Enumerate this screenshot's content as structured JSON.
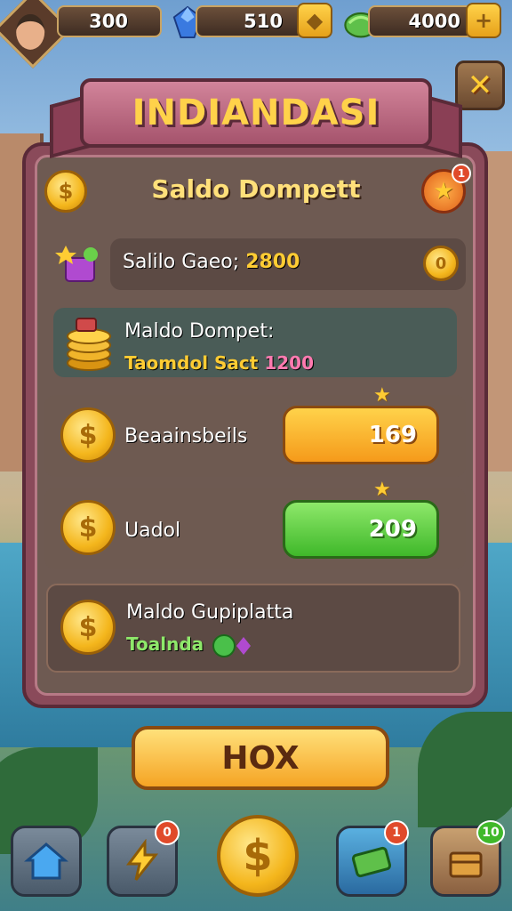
{
  "topbar": {
    "coins_value": "300",
    "gems_value": "510",
    "cash_value": "4000",
    "plus_label": "+"
  },
  "header": {
    "title": "INDIANDASI",
    "close_label": "✕"
  },
  "panel": {
    "title": "Saldo Dompett",
    "star_badge": "1",
    "rows": [
      {
        "label": "Salilo Gaeo;",
        "value": "2800"
      },
      {
        "label": "Maldo Dompet:",
        "sublabel": "Taomdol",
        "subvalue_label": "Sact",
        "subvalue": "1200"
      },
      {
        "label": "Beaainsbeils",
        "button_value": "169"
      },
      {
        "label": "Uadol",
        "button_value": "209"
      },
      {
        "label": "Maldo Gupiplatta",
        "sublabel": "Toalnda"
      }
    ]
  },
  "action_button": "HOX",
  "bottom_nav": {
    "badges": [
      "0",
      "1",
      "10"
    ]
  },
  "icons": {
    "coin": "coin-icon",
    "gem": "gem-icon",
    "cash": "cash-icon"
  },
  "colors": {
    "panel": "#8a4a5a",
    "title": "#ffd24a",
    "orange_button": "#f59a1a",
    "green_button": "#3fb82a"
  }
}
